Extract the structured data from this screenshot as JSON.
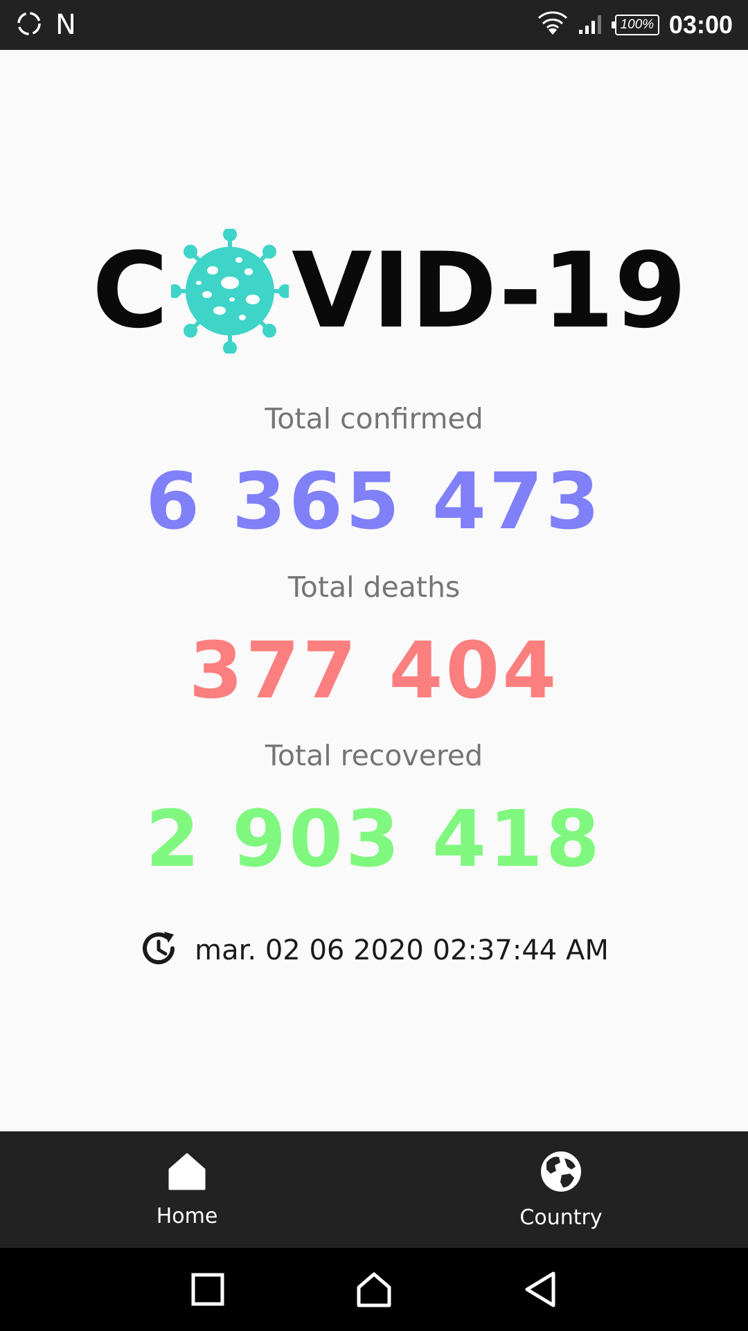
{
  "status_bar": {
    "notification_letter": "N",
    "battery_percent": "100%",
    "time": "03:00"
  },
  "logo": {
    "text_before": "C",
    "text_after": "VID-19"
  },
  "stats": {
    "confirmed": {
      "label": "Total confirmed",
      "value": "6 365 473",
      "color": "#8080f8"
    },
    "deaths": {
      "label": "Total deaths",
      "value": "377 404",
      "color": "#fb7f7f"
    },
    "recovered": {
      "label": "Total recovered",
      "value": "2 903 418",
      "color": "#80f880"
    }
  },
  "last_update": {
    "icon": "history-icon",
    "text": "mar. 02 06 2020 02:37:44 AM"
  },
  "bottom_nav": {
    "items": [
      {
        "label": "Home",
        "icon": "home-icon"
      },
      {
        "label": "Country",
        "icon": "globe-icon"
      }
    ]
  },
  "system_nav": {
    "icons": [
      "recents-icon",
      "home-icon",
      "back-icon"
    ]
  },
  "colors": {
    "status_bar_bg": "#222222",
    "background": "#fafafa",
    "virus_teal": "#3fd4c8",
    "bottom_nav_bg": "#222222"
  }
}
